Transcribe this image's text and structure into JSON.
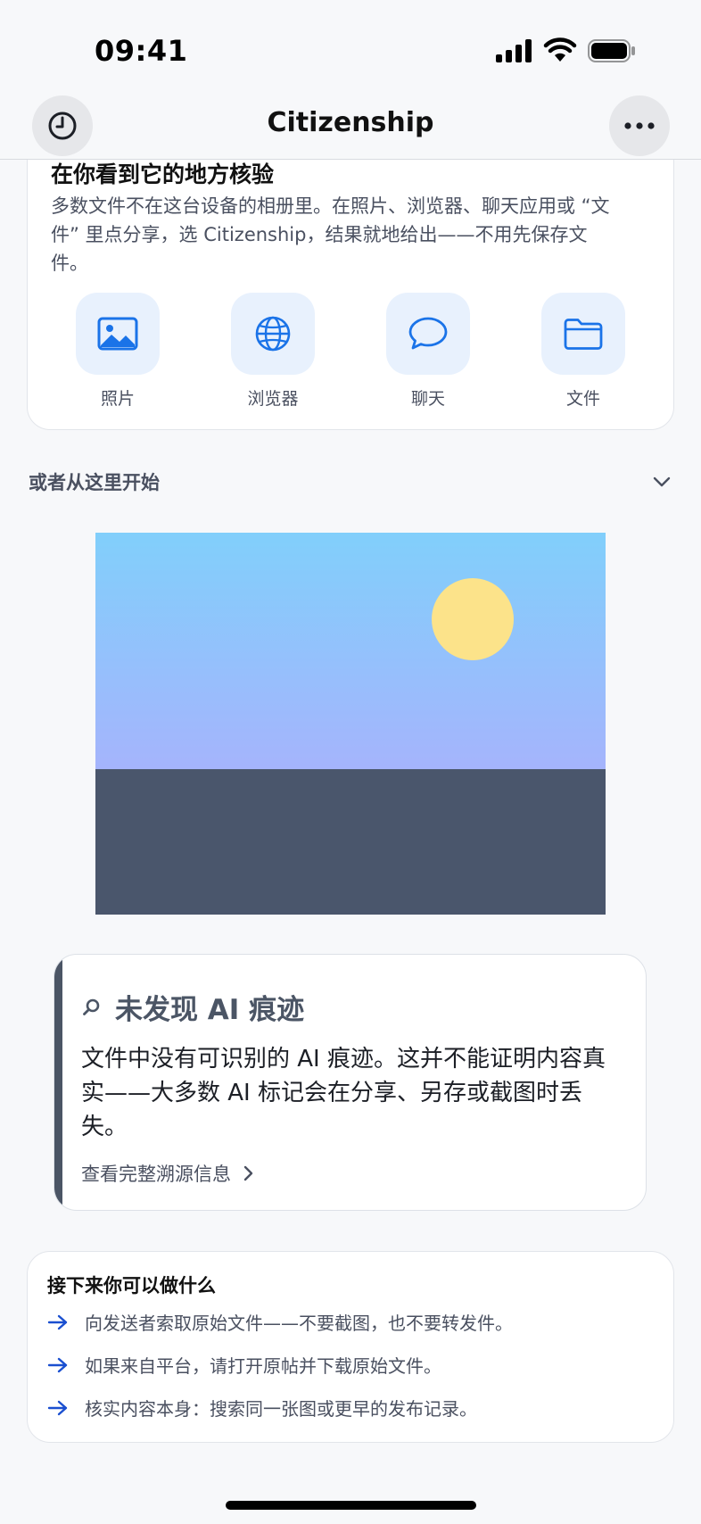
{
  "status_bar": {
    "time": "09:41"
  },
  "nav": {
    "title": "Citizenship",
    "left_icon": "history-clock-icon",
    "right_icon": "more-ellipsis-icon"
  },
  "verify_card": {
    "title": "在你看到它的地方核验",
    "description": "多数文件不在这台设备的相册里。在照片、浏览器、聊天应用或 “文件” 里点分享，选 Citizenship，结果就地给出——不用先保存文件。",
    "sources": [
      {
        "label": "照片",
        "icon": "photo-icon"
      },
      {
        "label": "浏览器",
        "icon": "globe-icon"
      },
      {
        "label": "聊天",
        "icon": "chat-bubble-icon"
      },
      {
        "label": "文件",
        "icon": "folder-icon"
      }
    ]
  },
  "start_section": {
    "label": "或者从这里开始",
    "icon": "chevron-down-icon"
  },
  "result": {
    "title": "未发现 AI 痕迹",
    "icon": "search-icon",
    "body": "文件中没有可识别的 AI 痕迹。这并不能证明内容真实——大多数 AI 标记会在分享、另存或截图时丢失。",
    "link": "查看完整溯源信息"
  },
  "next_steps": {
    "title": "接下来你可以做什么",
    "items": [
      "向发送者索取原始文件——不要截图，也不要转发件。",
      "如果来自平台，请打开原帖并下载原始文件。",
      "核实内容本身：搜索同一张图或更早的发布记录。"
    ]
  },
  "colors": {
    "accent_blue": "#1a73e8",
    "icon_tile": "#e8f1fd",
    "result_accent": "#4b5565",
    "sky_top": "#81cffb",
    "sky_bottom": "#a5b4fc",
    "sun": "#fce38a",
    "ground": "#4a566c"
  }
}
